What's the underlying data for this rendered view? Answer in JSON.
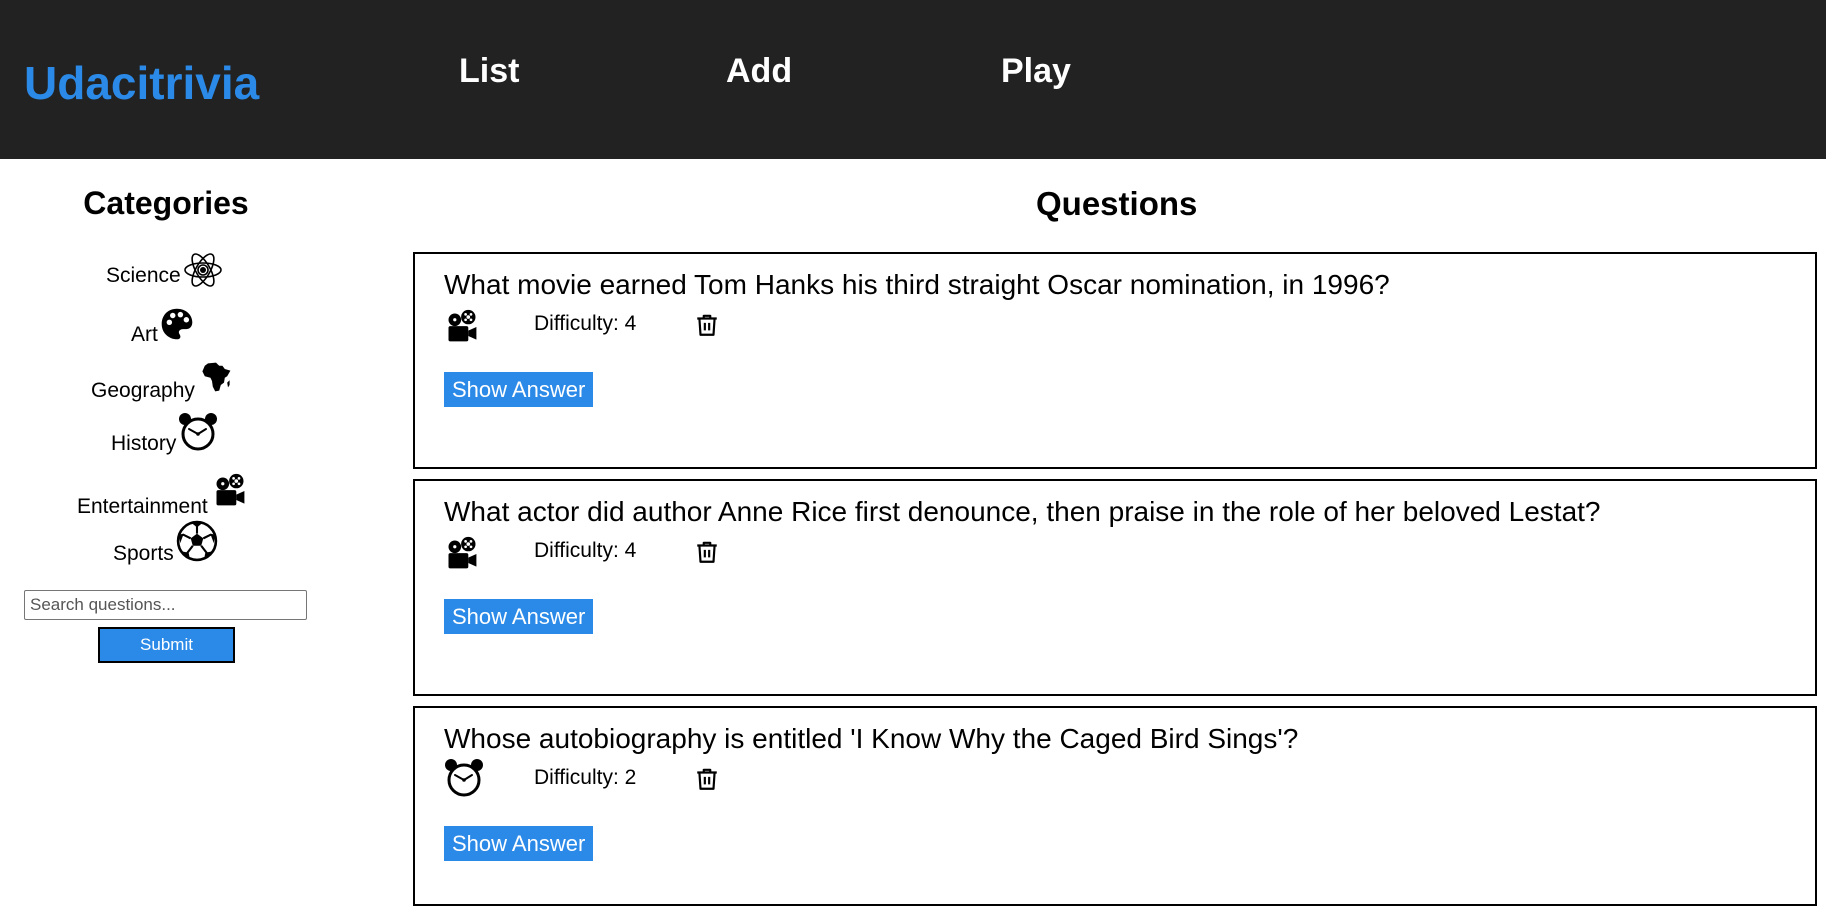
{
  "header": {
    "logo": "Udacitrivia",
    "nav": {
      "list": "List",
      "add": "Add",
      "play": "Play"
    }
  },
  "categories": {
    "title": "Categories",
    "items": [
      {
        "label": "Science",
        "icon": "atom-icon"
      },
      {
        "label": "Art",
        "icon": "palette-icon"
      },
      {
        "label": "Geography",
        "icon": "africa-map-icon"
      },
      {
        "label": "History",
        "icon": "alarm-clock-icon"
      },
      {
        "label": "Entertainment",
        "icon": "film-projector-icon"
      },
      {
        "label": "Sports",
        "icon": "soccer-ball-icon"
      }
    ]
  },
  "search": {
    "placeholder": "Search questions...",
    "value": "",
    "submit_label": "Submit"
  },
  "questions": {
    "title": "Questions",
    "items": [
      {
        "text": "What movie earned Tom Hanks his third straight Oscar nomination, in 1996?",
        "category_icon": "film-projector-icon",
        "difficulty": "Difficulty: 4",
        "show_answer": "Show Answer"
      },
      {
        "text": "What actor did author Anne Rice first denounce, then praise in the role of her beloved Lestat?",
        "category_icon": "film-projector-icon",
        "difficulty": "Difficulty: 4",
        "show_answer": "Show Answer"
      },
      {
        "text": "Whose autobiography is entitled 'I Know Why the Caged Bird Sings'?",
        "category_icon": "alarm-clock-icon",
        "difficulty": "Difficulty: 2",
        "show_answer": "Show Answer"
      }
    ]
  },
  "colors": {
    "header_bg": "#222222",
    "accent": "#2b8ae8",
    "text": "#000000"
  }
}
